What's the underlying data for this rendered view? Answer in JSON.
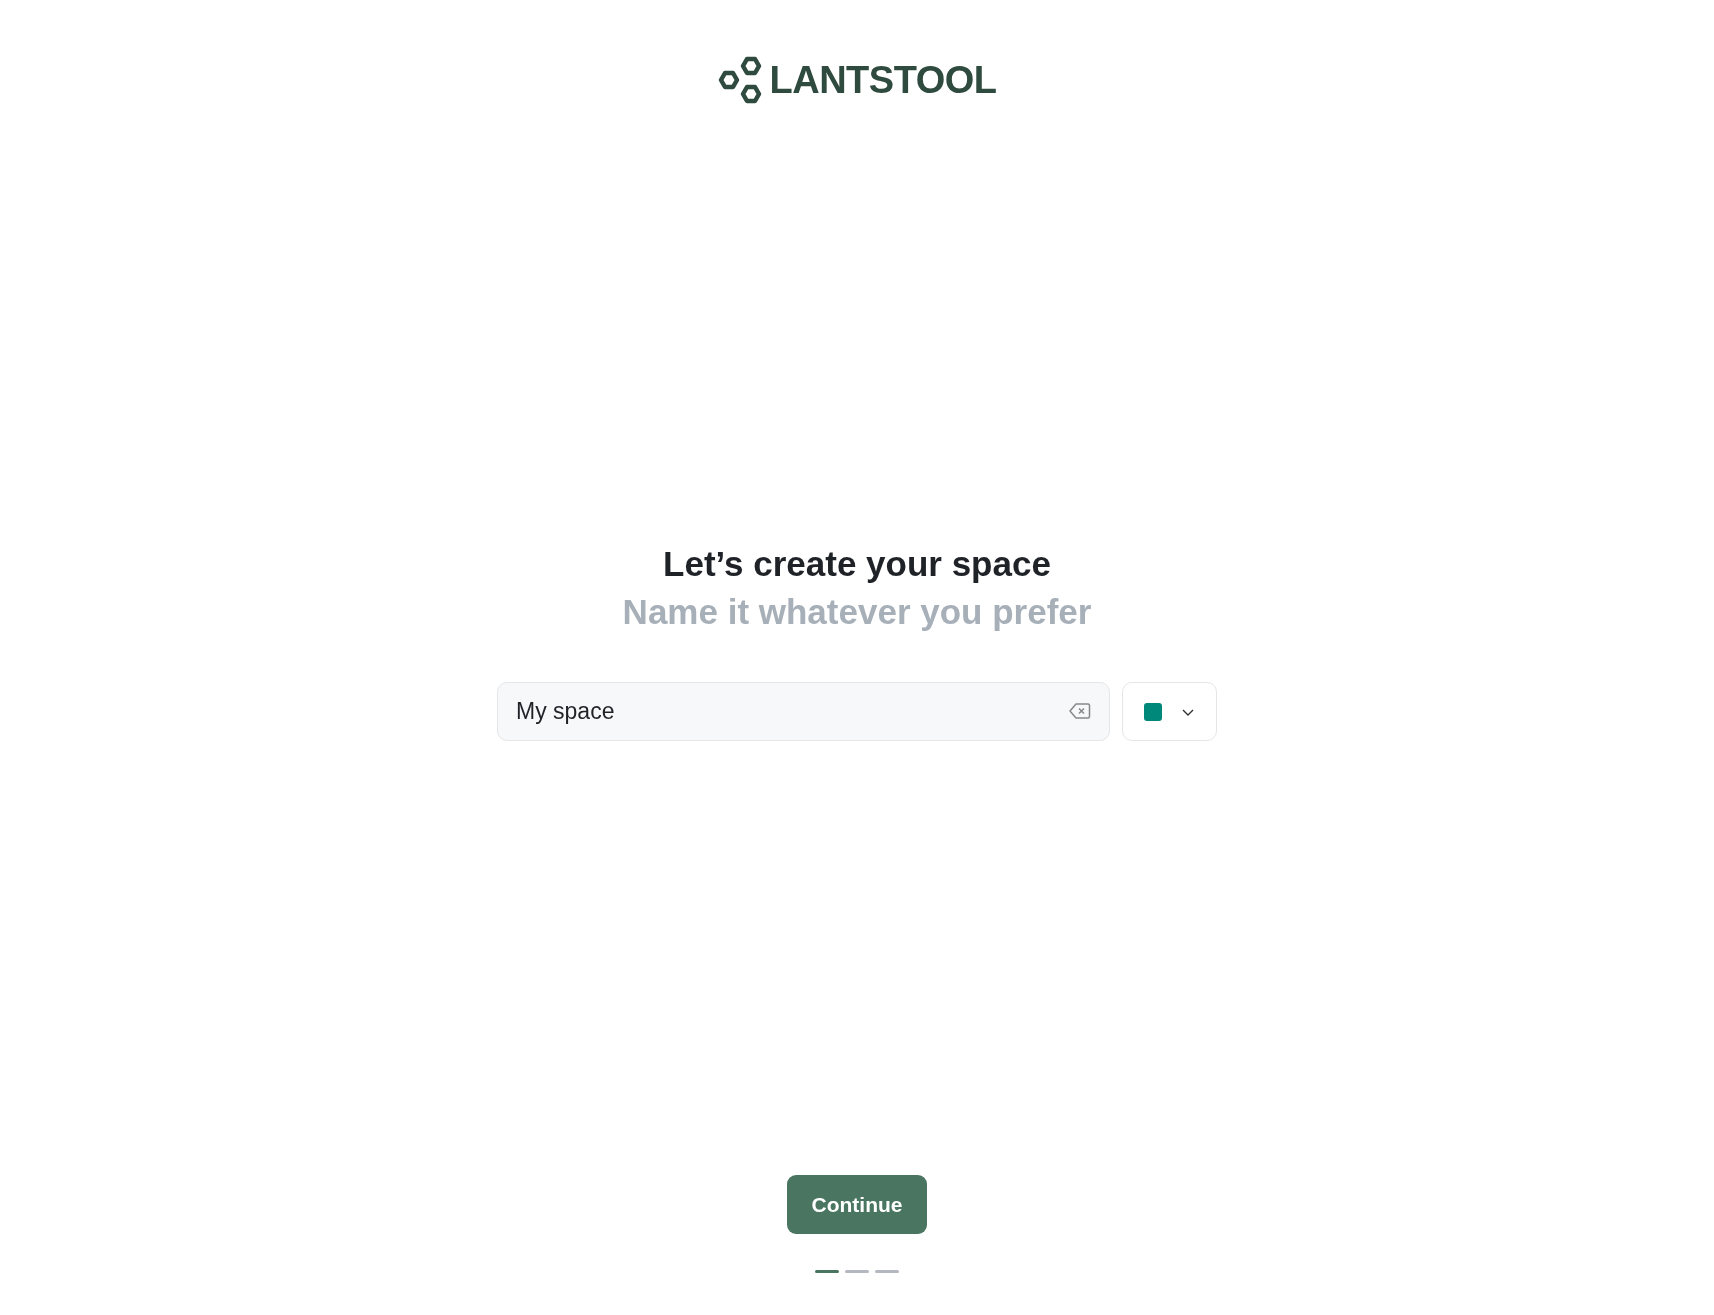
{
  "logo": {
    "text": "LANTSTOOL"
  },
  "heading": {
    "title": "Let’s create your space",
    "subtitle": "Name it whatever you prefer"
  },
  "name_field": {
    "value": "My space"
  },
  "color_picker": {
    "color": "#00897b"
  },
  "continue_button": {
    "label": "Continue"
  },
  "steps": [
    {
      "selected": true
    },
    {
      "selected": false
    },
    {
      "selected": false
    }
  ]
}
